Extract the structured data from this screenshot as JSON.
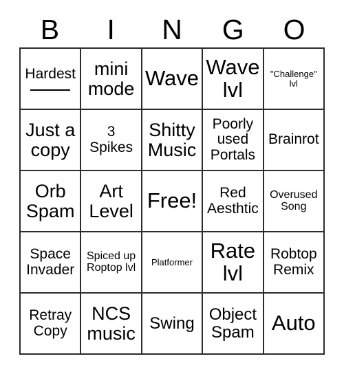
{
  "card": {
    "title": "BINGO",
    "header_letters": [
      "B",
      "I",
      "N",
      "G",
      "O"
    ],
    "free_space_index": 12,
    "colors": {
      "background": "#ffffff",
      "grid_line": "#2b2b2b",
      "text": "#000000"
    },
    "grid": {
      "columns": 5,
      "rows": 5
    },
    "cells": [
      {
        "text": "Hardest",
        "size": "md",
        "has_blank_line": true,
        "column": "B",
        "row": 1
      },
      {
        "text": "mini\nmode",
        "size": "xl",
        "has_blank_line": false,
        "column": "I",
        "row": 1
      },
      {
        "text": "Wave",
        "size": "xxl",
        "has_blank_line": false,
        "column": "N",
        "row": 1
      },
      {
        "text": "Wave\nlvl",
        "size": "xxl",
        "has_blank_line": false,
        "column": "G",
        "row": 1
      },
      {
        "text": "\"Challenge\"\nlvl",
        "size": "xs",
        "has_blank_line": false,
        "column": "O",
        "row": 1
      },
      {
        "text": "Just a\ncopy",
        "size": "xl",
        "has_blank_line": false,
        "column": "B",
        "row": 2
      },
      {
        "text": "3\nSpikes",
        "size": "md",
        "has_blank_line": false,
        "column": "I",
        "row": 2
      },
      {
        "text": "Shitty\nMusic",
        "size": "xl",
        "has_blank_line": false,
        "column": "N",
        "row": 2
      },
      {
        "text": "Poorly\nused\nPortals",
        "size": "md",
        "has_blank_line": false,
        "column": "G",
        "row": 2
      },
      {
        "text": "Brainrot",
        "size": "md",
        "has_blank_line": false,
        "column": "O",
        "row": 2
      },
      {
        "text": "Orb\nSpam",
        "size": "xl",
        "has_blank_line": false,
        "column": "B",
        "row": 3
      },
      {
        "text": "Art\nLevel",
        "size": "xl",
        "has_blank_line": false,
        "column": "I",
        "row": 3
      },
      {
        "text": "Free!",
        "size": "xxl",
        "has_blank_line": false,
        "column": "N",
        "row": 3
      },
      {
        "text": "Red\nAesthtic",
        "size": "md",
        "has_blank_line": false,
        "column": "G",
        "row": 3
      },
      {
        "text": "Overused\nSong",
        "size": "sm",
        "has_blank_line": false,
        "column": "O",
        "row": 3
      },
      {
        "text": "Space\nInvader",
        "size": "md",
        "has_blank_line": false,
        "column": "B",
        "row": 4
      },
      {
        "text": "Spiced up\nRoptop lvl",
        "size": "sm",
        "has_blank_line": false,
        "column": "I",
        "row": 4
      },
      {
        "text": "Platformer",
        "size": "xs",
        "has_blank_line": false,
        "column": "N",
        "row": 4
      },
      {
        "text": "Rate\nlvl",
        "size": "xxl",
        "has_blank_line": false,
        "column": "G",
        "row": 4
      },
      {
        "text": "Robtop\nRemix",
        "size": "md",
        "has_blank_line": false,
        "column": "O",
        "row": 4
      },
      {
        "text": "Retray\nCopy",
        "size": "md",
        "has_blank_line": false,
        "column": "B",
        "row": 5
      },
      {
        "text": "NCS\nmusic",
        "size": "xl",
        "has_blank_line": false,
        "column": "I",
        "row": 5
      },
      {
        "text": "Swing",
        "size": "lg",
        "has_blank_line": false,
        "column": "N",
        "row": 5
      },
      {
        "text": "Object\nSpam",
        "size": "lg",
        "has_blank_line": false,
        "column": "G",
        "row": 5
      },
      {
        "text": "Auto",
        "size": "xxl",
        "has_blank_line": false,
        "column": "O",
        "row": 5
      }
    ]
  }
}
